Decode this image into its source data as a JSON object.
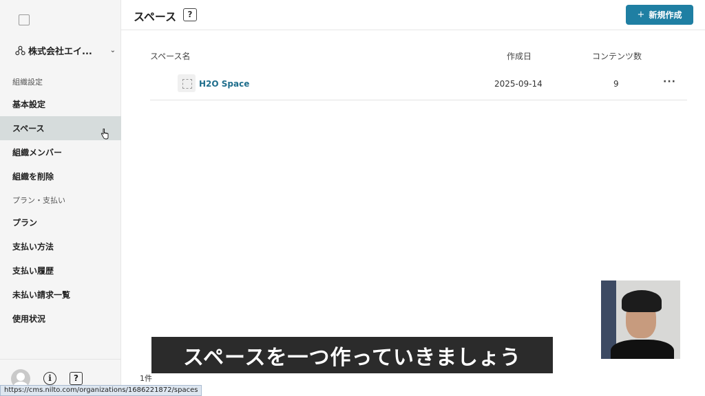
{
  "org": {
    "name": "株式会社エイ..."
  },
  "sidebar": {
    "sections": [
      {
        "title": "組織設定"
      },
      {
        "title": "プラン・支払い"
      }
    ],
    "items": [
      {
        "label": "基本設定"
      },
      {
        "label": "スペース",
        "active": true
      },
      {
        "label": "組織メンバー"
      },
      {
        "label": "組織を削除"
      },
      {
        "label": "プラン"
      },
      {
        "label": "支払い方法"
      },
      {
        "label": "支払い履歴"
      },
      {
        "label": "未払い請求一覧"
      },
      {
        "label": "使用状況"
      }
    ]
  },
  "header": {
    "title": "スペース",
    "help_icon": "?",
    "new_button": {
      "icon": "+",
      "label": "新規作成"
    }
  },
  "table": {
    "columns": {
      "name": "スペース名",
      "created": "作成日",
      "count": "コンテンツ数"
    },
    "rows": [
      {
        "name": "H2O Space",
        "created": "2025-09-14",
        "count": "9",
        "menu": "···"
      }
    ],
    "total": "1件"
  },
  "footer": {
    "info_icon": "i",
    "help_icon": "?"
  },
  "overlay": {
    "subtitle": "スペースを一つ作っていきましょう",
    "status_url": "https://cms.nilto.com/organizations/1686221872/spaces"
  },
  "colors": {
    "accent": "#1f7fa3",
    "link": "#1f6e8c",
    "active_bg": "#d6dcdc"
  }
}
